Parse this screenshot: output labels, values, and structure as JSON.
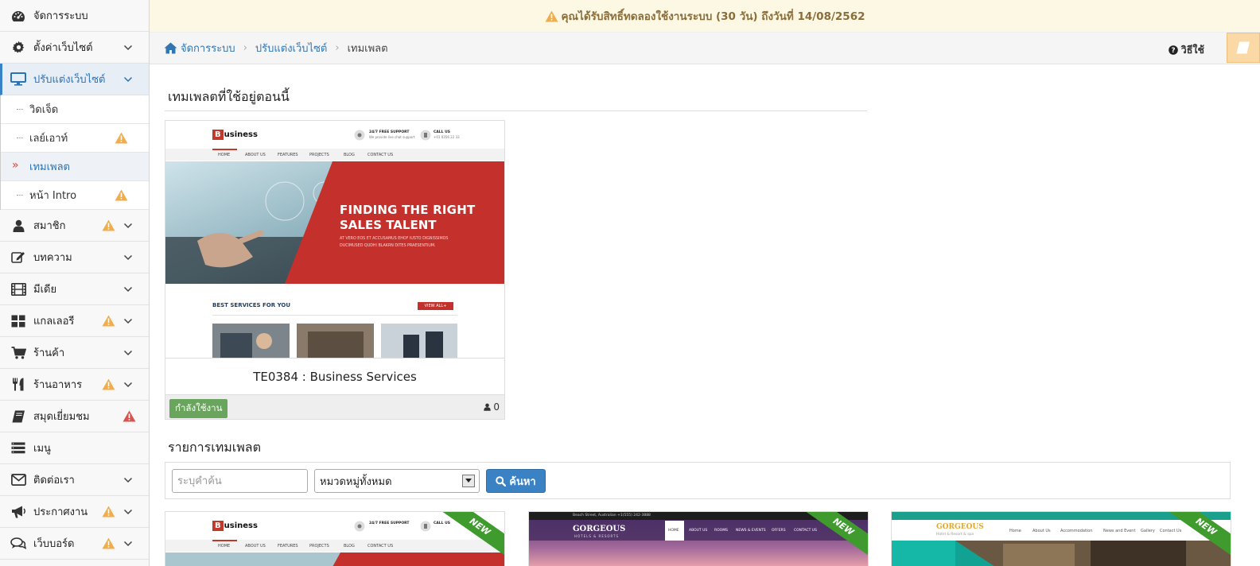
{
  "sidebar": {
    "items": [
      {
        "label": "จัดการระบบ"
      },
      {
        "label": "ตั้งค่าเว็บไซต์"
      },
      {
        "label": "ปรับแต่งเว็บไซต์"
      },
      {
        "label": "สมาชิก"
      },
      {
        "label": "บทความ"
      },
      {
        "label": "มีเดีย"
      },
      {
        "label": "แกลเลอรี"
      },
      {
        "label": "ร้านค้า"
      },
      {
        "label": "ร้านอาหาร"
      },
      {
        "label": "สมุดเยี่ยมชม"
      },
      {
        "label": "เมนู"
      },
      {
        "label": "ติดต่อเรา"
      },
      {
        "label": "ประกาศงาน"
      },
      {
        "label": "เว็บบอร์ด"
      }
    ],
    "sub_items": [
      {
        "label": "วิดเจ็ด"
      },
      {
        "label": "เลย์เอาท์"
      },
      {
        "label": "เทมเพลต"
      },
      {
        "label": "หน้า Intro"
      }
    ]
  },
  "banner": {
    "text": "คุณได้รับสิทธิ์ทดลองใช้งานระบบ (30 วัน) ถึงวันที่ 14/08/2562"
  },
  "breadcrumb": {
    "home": "จัดการระบบ",
    "parent": "ปรับแต่งเว็บไซต์",
    "current": "เทมเพลต"
  },
  "help": {
    "label": "วิธีใช้"
  },
  "current_section": {
    "title": "เทมเพลตที่ใช้อยู่ตอนนี้"
  },
  "current_template": {
    "name": "TE0384 : Business Services",
    "status": "กำลังใช้งาน",
    "count": "0",
    "thumb": {
      "logo_letter": "B",
      "logo_rest": "usiness",
      "support_title": "24/7 FREE SUPPORT",
      "support_sub": "We provide live chat support",
      "call_title": "CALL US",
      "call_sub": "+01 0356 22 33",
      "nav": [
        "HOME",
        "ABOUT US",
        "FEATURES",
        "PROJECTS",
        "BLOG",
        "CONTACT US"
      ],
      "hero_title_1": "FINDING THE RIGHT",
      "hero_title_2": "SALES TALENT",
      "hero_sub_1": "AT VERO EOS ET ACCUSAMUS EHOF IUSTO DIGNISSIMOS",
      "hero_sub_2": "DUCIMUSED QUDHI BLAKRN DITES PRAESENTIUM.",
      "services_title": "BEST SERVICES FOR YOU",
      "view_all": "VIEW ALL+"
    }
  },
  "list_section": {
    "title": "รายการเทมเพลต"
  },
  "search": {
    "placeholder": "ระบุคำค้น",
    "category": "หมวดหมู่ทั้งหมด",
    "button": "ค้นหา"
  },
  "list_templates": [
    {
      "ribbon": "NEW",
      "logo_letter": "B",
      "logo_rest": "usiness",
      "support_title": "24/7 FREE SUPPORT",
      "call_title": "CALL US",
      "nav": [
        "HOME",
        "ABOUT US",
        "FEATURES",
        "PROJECTS",
        "BLOG",
        "CONTACT US"
      ]
    },
    {
      "ribbon": "NEW",
      "brand": "GORGEOUS",
      "brand_sub": "HOTELS & RESORTS",
      "topline": "Beach Street, Australian  +1(555) 242-3888",
      "nav": [
        "HOME",
        "ABOUT US",
        "ROOMS",
        "NEWS & EVENTS",
        "OFFERS",
        "CONTACT US"
      ]
    },
    {
      "ribbon": "NEW",
      "brand": "GORGEOUS",
      "brand_sub": "Hotel & Resort & spa",
      "nav": [
        "Home",
        "About Us",
        "Accommodation",
        "News and Event",
        "Gallery",
        "Contact Us"
      ]
    }
  ],
  "colors": {
    "accent": "#3a82c6",
    "banner_bg": "#fcf8e3",
    "banner_text": "#8a6d3b",
    "warning": "#f0ad4e",
    "danger": "#d9534f",
    "success": "#6aa55e",
    "hero_red": "#c4302b",
    "ribbon": "#3f9b2e"
  }
}
